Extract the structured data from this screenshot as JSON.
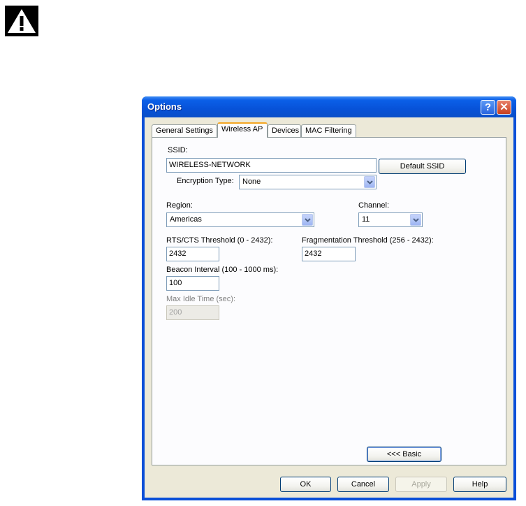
{
  "dialog": {
    "title": "Options",
    "help_glyph": "?",
    "close_glyph": "✕"
  },
  "tabs": [
    "General Settings",
    "Wireless AP",
    "Devices",
    "MAC Filtering"
  ],
  "active_tab": "Wireless AP",
  "wireless_ap": {
    "ssid_label": "SSID:",
    "ssid_value": "WIRELESS-NETWORK",
    "default_ssid_button": "Default SSID",
    "encryption_label": "Encryption Type:",
    "encryption_value": "None",
    "region_label": "Region:",
    "region_value": "Americas",
    "channel_label": "Channel:",
    "channel_value": "11",
    "rts_label": "RTS/CTS Threshold (0 - 2432):",
    "rts_value": "2432",
    "frag_label": "Fragmentation Threshold (256 - 2432):",
    "frag_value": "2432",
    "beacon_label": "Beacon Interval (100 - 1000 ms):",
    "beacon_value": "100",
    "idle_label": "Max Idle Time (sec):",
    "idle_value": "200",
    "basic_button": "<<< Basic"
  },
  "footer": {
    "ok": "OK",
    "cancel": "Cancel",
    "apply": "Apply",
    "help": "Help"
  },
  "icons": {
    "warning": "warning-icon",
    "dropdown": "chevron-down-icon"
  },
  "colors": {
    "title_bar": "#0752d8",
    "dialog_face": "#ece9d8",
    "active_tab_accent": "#f5a623"
  }
}
